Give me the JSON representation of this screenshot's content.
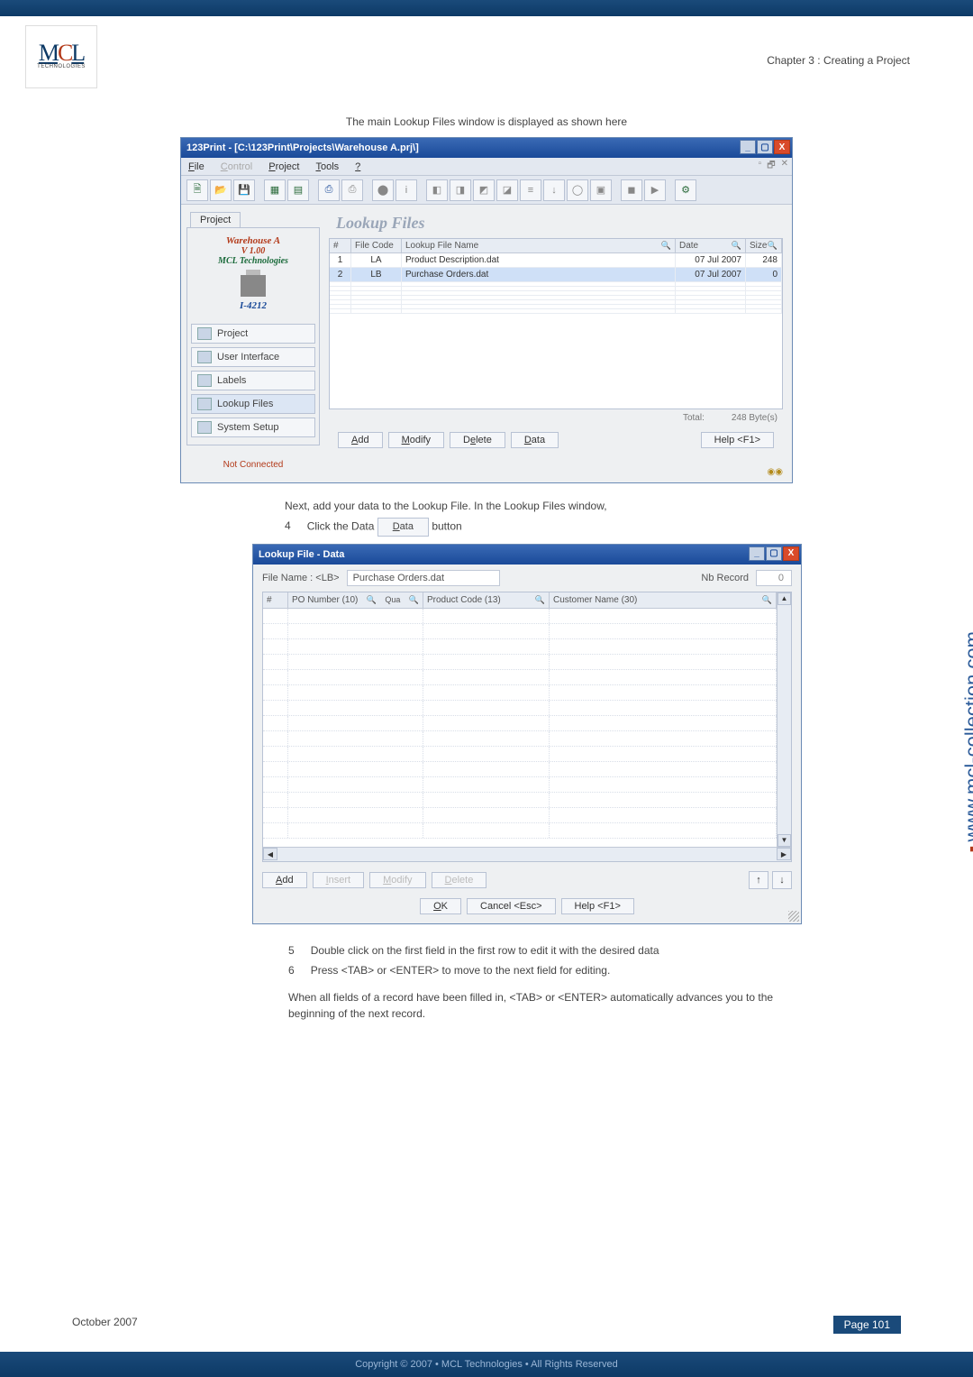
{
  "chapter": "Chapter 3 : Creating a Project",
  "logo": {
    "top": "MCL",
    "bottom": "TECHNOLOGIES"
  },
  "caption1": "The main Lookup Files window is displayed as shown here",
  "win1": {
    "title": "123Print - [C:\\123Print\\Projects\\Warehouse A.prj\\]",
    "menu": {
      "file": "File",
      "control": "Control",
      "project": "Project",
      "tools": "Tools",
      "help": "?"
    },
    "project_tab": "Project",
    "warehouse_name": "Warehouse A",
    "warehouse_ver": "V 1.00",
    "warehouse_mcl": "MCL Technologies",
    "printer_model": "I-4212",
    "nav": {
      "project": "Project",
      "ui": "User Interface",
      "labels": "Labels",
      "lookup": "Lookup Files",
      "system": "System Setup"
    },
    "not_connected": "Not Connected",
    "lf_title": "Lookup Files",
    "grid": {
      "headers": {
        "num": "#",
        "file_code": "File Code",
        "file_name": "Lookup File Name",
        "date": "Date",
        "size": "Size"
      },
      "rows": [
        {
          "num": "1",
          "code": "LA",
          "name": "Product Description.dat",
          "date": "07 Jul 2007",
          "size": "248"
        },
        {
          "num": "2",
          "code": "LB",
          "name": "Purchase Orders.dat",
          "date": "07 Jul 2007",
          "size": "0"
        }
      ],
      "total_label": "Total:",
      "total_bytes": "248 Byte(s)"
    },
    "buttons": {
      "add": "Add",
      "modify": "Modify",
      "delete": "Delete",
      "data": "Data",
      "help": "Help <F1>"
    }
  },
  "caption2_intro": "Next, add your data to the Lookup File. In the Lookup Files window,",
  "step4_num": "4",
  "step4_a": "Click the Data ",
  "step4_btn": "Data",
  "step4_b": " button",
  "win2": {
    "title": "Lookup File - Data",
    "file_name_label": "File Name : <LB>",
    "file_name_value": "Purchase Orders.dat",
    "nb_record_label": "Nb Record",
    "nb_record_value": "0",
    "headers": {
      "num": "#",
      "po": "PO Number (10)",
      "qty": "Qua",
      "pc": "Product Code (13)",
      "cn": "Customer Name (30)"
    },
    "buttons": {
      "add": "Add",
      "insert": "Insert",
      "modify": "Modify",
      "delete": "Delete",
      "ok": "OK",
      "cancel": "Cancel <Esc>",
      "help": "Help <F1>"
    }
  },
  "step5_num": "5",
  "step5": "Double click on the first field in the first row to edit it with the desired data",
  "step6_num": "6",
  "step6": "Press <TAB> or <ENTER> to move to the next field for editing.",
  "when_para": "When all fields of a record have been filled in, <TAB> or <ENTER> automatically advances you to the beginning of the next record.",
  "side_url": "www.mcl-collection.com",
  "footer_date": "October 2007",
  "footer_page": "Page 101",
  "copyright": "Copyright © 2007 • MCL Technologies • All Rights Reserved"
}
